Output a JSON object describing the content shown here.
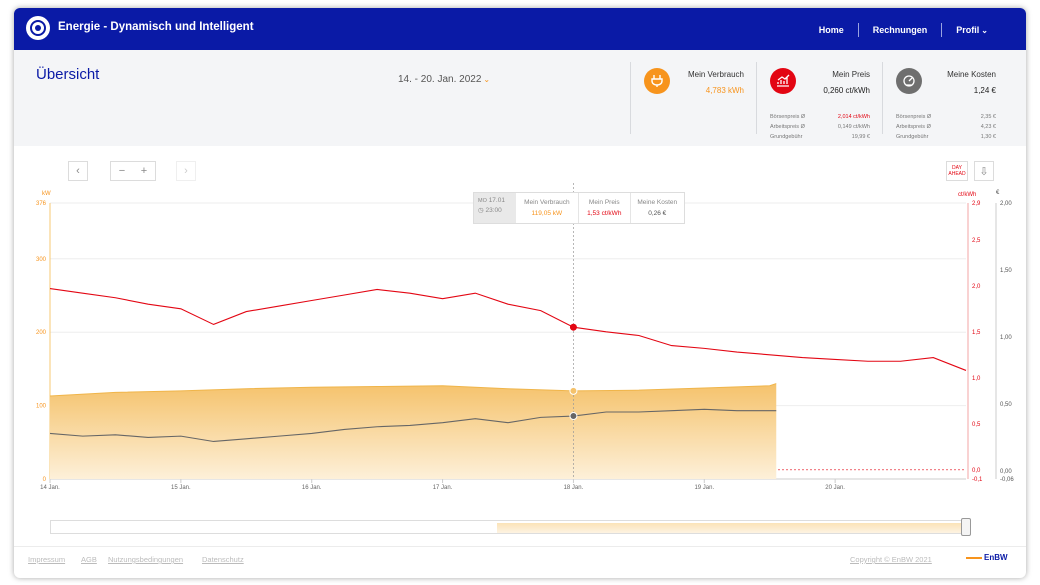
{
  "app": {
    "title": "Energie - Dynamisch und Intelligent"
  },
  "nav": {
    "home": "Home",
    "invoices": "Rechnungen",
    "profile": "Profil"
  },
  "header": {
    "title": "Übersicht",
    "date_range": "14. - 20. Jan. 2022"
  },
  "kpis": {
    "consumption": {
      "label": "Mein Verbrauch",
      "value": "4,783 kWh",
      "icon": "plug-icon",
      "color": "#f7941d"
    },
    "price": {
      "label": "Mein Preis",
      "value": "0,260 ct/kWh",
      "icon": "price-chart-icon",
      "color": "#e30613",
      "rows": [
        {
          "label": "Börsenpreis Ø",
          "value": "2,014 ct/kWh",
          "highlight": true
        },
        {
          "label": "Arbeitspreis Ø",
          "value": "0,149 ct/kWh",
          "highlight": false
        },
        {
          "label": "Grundgebühr",
          "value": "19,99 €",
          "highlight": false
        }
      ]
    },
    "costs": {
      "label": "Meine Kosten",
      "value": "1,24 €",
      "icon": "cost-gauge-icon",
      "color": "#6f6f6f",
      "rows": [
        {
          "label": "Börsenpreis Ø",
          "value": "2,35 €"
        },
        {
          "label": "Arbeitspreis Ø",
          "value": "4,23 €"
        },
        {
          "label": "Grundgebühr",
          "value": "1,30 €"
        }
      ]
    }
  },
  "controls": {
    "prev": "‹",
    "zoom_out": "−",
    "zoom_in": "+",
    "next": "›",
    "day_ahead": "DAY AHEAD",
    "download": "⇩"
  },
  "tooltip": {
    "day": "MO",
    "date": "17.01",
    "time": "23:00",
    "cols": [
      {
        "label": "Mein Verbrauch",
        "value": "119,05 kW",
        "color": "#f7941d"
      },
      {
        "label": "Mein Preis",
        "value": "1,53 ct/kWh",
        "color": "#e30613"
      },
      {
        "label": "Meine Kosten",
        "value": "0,26 €",
        "color": "#555555"
      }
    ]
  },
  "chart_data": {
    "type": "area",
    "x_labels": [
      "14 Jan.",
      "15 Jan.",
      "16 Jan.",
      "17 Jan.",
      "18 Jan.",
      "19 Jan.",
      "20 Jan."
    ],
    "left_axis": {
      "unit": "kW",
      "ticks": [
        "376",
        "300",
        "200",
        "100",
        "0"
      ],
      "range": [
        0,
        376
      ],
      "color": "#f7941d"
    },
    "right_axis_price": {
      "unit": "ct/kWh",
      "ticks": [
        "2,9",
        "2,5",
        "2,0",
        "1,5",
        "1,0",
        "0,5",
        "0,0",
        "-0,1"
      ],
      "range": [
        -0.1,
        2.9
      ],
      "color": "#e30613"
    },
    "right_axis_cost": {
      "unit": "€",
      "ticks": [
        "2,00",
        "1,50",
        "1,00",
        "0,50",
        "0,00",
        "-0,06"
      ],
      "range": [
        -0.06,
        2.0
      ],
      "color": "#555555"
    },
    "series": [
      {
        "name": "Mein Verbrauch",
        "kind": "area",
        "color": "#f7c873",
        "points": [
          [
            0,
            113
          ],
          [
            0.5,
            118
          ],
          [
            1,
            120
          ],
          [
            1.5,
            123
          ],
          [
            2,
            125
          ],
          [
            2.5,
            126
          ],
          [
            3,
            127
          ],
          [
            3.5,
            123
          ],
          [
            4,
            120
          ],
          [
            4.5,
            121
          ],
          [
            5,
            124
          ],
          [
            5.5,
            127
          ],
          [
            5.55,
            130
          ]
        ]
      },
      {
        "name": "Mein Preis",
        "kind": "line",
        "color": "#e30613",
        "points": [
          [
            0,
            1.97
          ],
          [
            0.25,
            1.92
          ],
          [
            0.5,
            1.87
          ],
          [
            0.75,
            1.8
          ],
          [
            1,
            1.75
          ],
          [
            1.25,
            1.58
          ],
          [
            1.5,
            1.72
          ],
          [
            1.75,
            1.78
          ],
          [
            2,
            1.84
          ],
          [
            2.25,
            1.9
          ],
          [
            2.5,
            1.96
          ],
          [
            2.75,
            1.92
          ],
          [
            3,
            1.86
          ],
          [
            3.25,
            1.92
          ],
          [
            3.5,
            1.8
          ],
          [
            3.75,
            1.73
          ],
          [
            4,
            1.55
          ],
          [
            4.25,
            1.5
          ],
          [
            4.5,
            1.46
          ],
          [
            4.75,
            1.35
          ],
          [
            5,
            1.32
          ],
          [
            5.25,
            1.28
          ],
          [
            5.5,
            1.25
          ],
          [
            5.75,
            1.22
          ],
          [
            6,
            1.2
          ],
          [
            6.25,
            1.18
          ],
          [
            6.5,
            1.18
          ],
          [
            6.75,
            1.22
          ],
          [
            7,
            1.08
          ]
        ]
      },
      {
        "name": "Meine Kosten",
        "kind": "line",
        "color": "#666666",
        "points": [
          [
            0,
            0.28
          ],
          [
            0.25,
            0.26
          ],
          [
            0.5,
            0.27
          ],
          [
            0.75,
            0.25
          ],
          [
            1,
            0.26
          ],
          [
            1.25,
            0.22
          ],
          [
            1.5,
            0.24
          ],
          [
            1.75,
            0.26
          ],
          [
            2,
            0.28
          ],
          [
            2.25,
            0.31
          ],
          [
            2.5,
            0.33
          ],
          [
            2.75,
            0.34
          ],
          [
            3,
            0.36
          ],
          [
            3.25,
            0.39
          ],
          [
            3.5,
            0.36
          ],
          [
            3.75,
            0.4
          ],
          [
            4,
            0.41
          ],
          [
            4.25,
            0.44
          ],
          [
            4.5,
            0.44
          ],
          [
            4.75,
            0.45
          ],
          [
            5,
            0.46
          ],
          [
            5.25,
            0.45
          ],
          [
            5.5,
            0.45
          ],
          [
            5.55,
            0.45
          ]
        ]
      }
    ],
    "highlight_x": 4.0
  },
  "footer": {
    "links": [
      "Impressum",
      "AGB",
      "Nutzungsbedingungen",
      "Datenschutz"
    ],
    "copyright": "Copyright © EnBW 2021",
    "brand": "EnBW"
  }
}
